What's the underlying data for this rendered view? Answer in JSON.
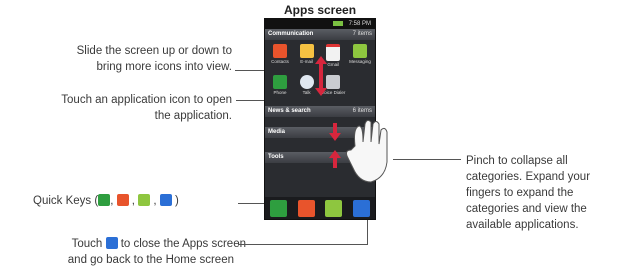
{
  "title": "Apps screen",
  "annotations": {
    "slide": [
      "Slide the screen up or down to",
      "bring more icons into view."
    ],
    "touch_app": [
      "Touch an application icon to open",
      "the application."
    ],
    "quick_keys_prefix": "Quick Keys (",
    "quick_keys_suffix": " )",
    "quick_keys_separator": ",",
    "touch_close_prefix": "Touch ",
    "touch_close_suffix": " to close the Apps screen",
    "touch_close_line2": "and go back to the Home screen",
    "pinch": [
      "Pinch to collapse all",
      "categories. Expand your",
      "fingers to expand the",
      "categories and view the",
      "available applications."
    ]
  },
  "phone": {
    "status_time": "7:58 PM",
    "categories": [
      {
        "name": "Communication",
        "count": "7 items"
      },
      {
        "name": "News & search",
        "count": "6 items"
      },
      {
        "name": "Media",
        "count": ""
      },
      {
        "name": "Tools",
        "count": ""
      }
    ],
    "apps": [
      "Contacts",
      "E-mail",
      "Gmail",
      "Messaging",
      "Phone",
      "Talk",
      "Voice Dialer"
    ]
  },
  "colors": {
    "phone_icon": "#2e9e3f",
    "contacts_icon": "#e8542c",
    "messaging_icon": "#8ec63f",
    "home_icon": "#2b6fd6",
    "apps_key": "#2b6fd6",
    "arrow": "#d7263d"
  }
}
